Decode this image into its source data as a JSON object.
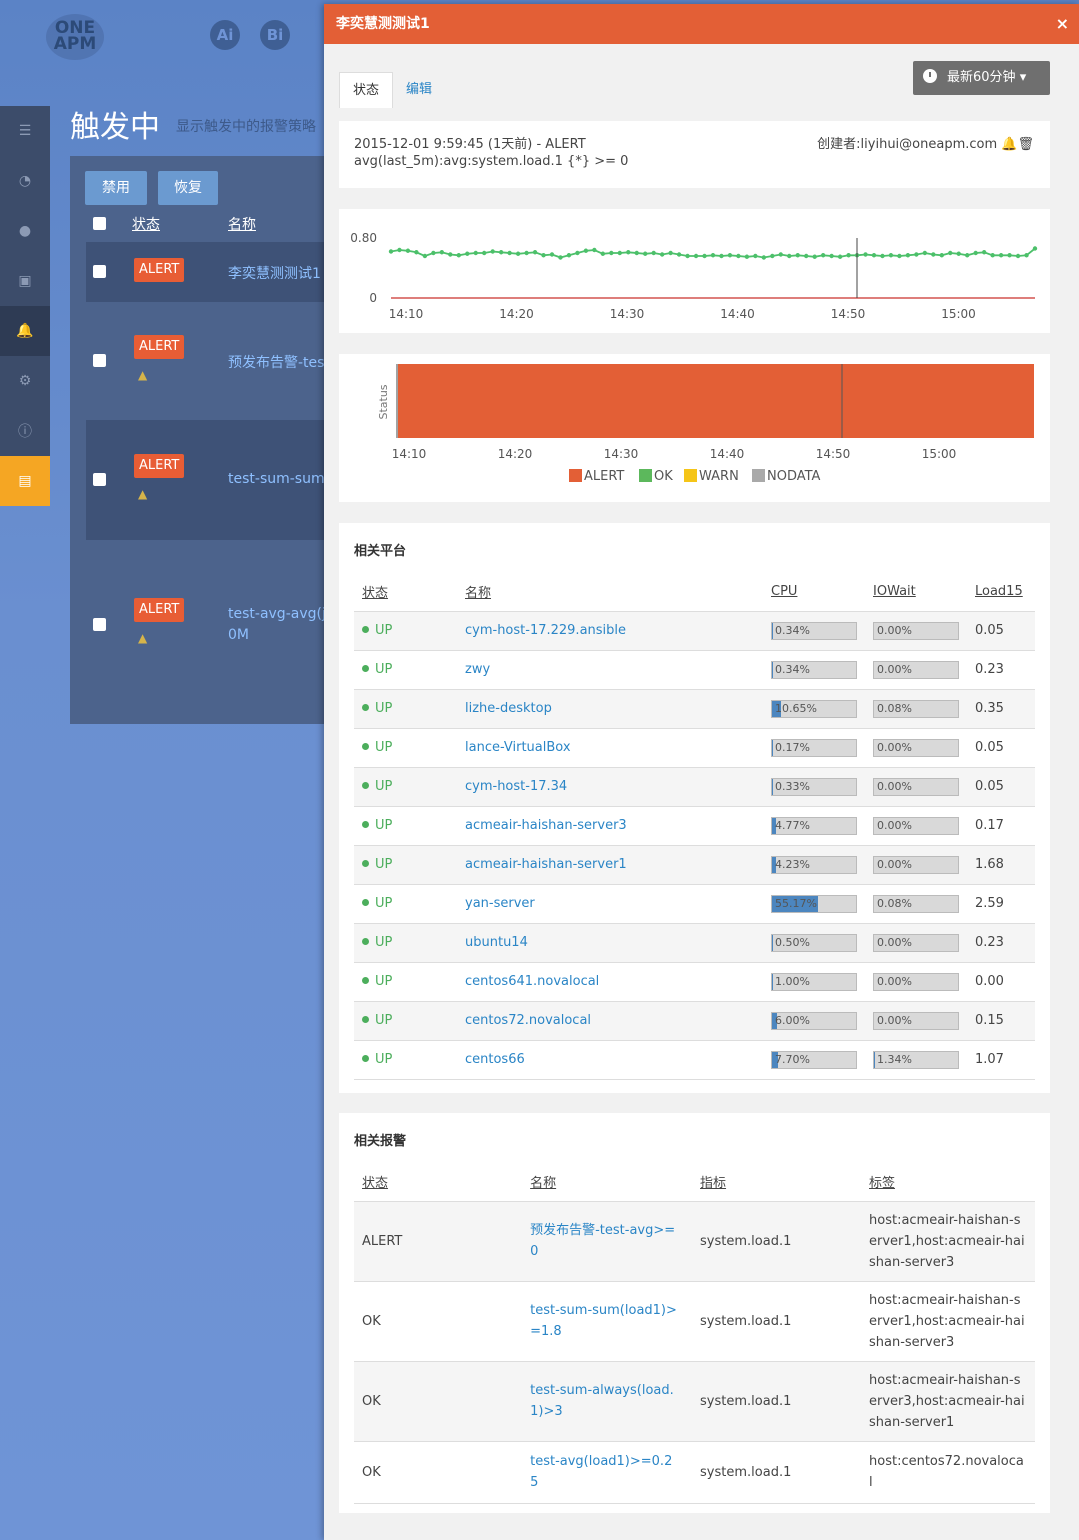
{
  "background": {
    "logo_text": "ONE APM",
    "top_icons": [
      "Ai",
      "Bi"
    ],
    "page_title": "触发中",
    "page_subtitle": "显示触发中的报警策略",
    "buttons": {
      "disable": "禁用",
      "restore": "恢复"
    },
    "headers": {
      "status": "状态",
      "name": "名称"
    },
    "rows": [
      {
        "status": "ALERT",
        "name": "李奕慧测测试1",
        "muted": false
      },
      {
        "status": "ALERT",
        "name": "预发布告警-test",
        "muted": true
      },
      {
        "status": "ALERT",
        "name": "test-sum-sum(l",
        "muted": true
      },
      {
        "status": "ALERT",
        "name": "test-avg-avg(jvm",
        "name2": "0M",
        "muted": true
      }
    ]
  },
  "modal": {
    "title": "李奕慧测测试1",
    "close": "×",
    "tabs": [
      "状态",
      "编辑"
    ],
    "time_button": "最新60分钟",
    "alert_info": {
      "line1": "2015-12-01 9:59:45  (1天前) - ALERT",
      "line2": "avg(last_5m):avg:system.load.1 {*} >= 0",
      "creator": "创建者:liyihui@oneapm.com"
    },
    "status_chart_label": "Status",
    "legend": [
      "ALERT",
      "OK",
      "WARN",
      "NODATA"
    ],
    "platforms": {
      "title": "相关平台",
      "headers": [
        "状态",
        "名称",
        "CPU",
        "IOWait",
        "Load15"
      ],
      "rows": [
        {
          "status": "UP",
          "name": "cym-host-17.229.ansible",
          "cpu": "0.34%",
          "cpu_v": 0.34,
          "iowait": "0.00%",
          "io_v": 0.0,
          "load": "0.05"
        },
        {
          "status": "UP",
          "name": "zwy",
          "cpu": "0.34%",
          "cpu_v": 0.34,
          "iowait": "0.00%",
          "io_v": 0.0,
          "load": "0.23"
        },
        {
          "status": "UP",
          "name": "lizhe-desktop",
          "cpu": "10.65%",
          "cpu_v": 10.65,
          "iowait": "0.08%",
          "io_v": 0.08,
          "load": "0.35"
        },
        {
          "status": "UP",
          "name": "lance-VirtualBox",
          "cpu": "0.17%",
          "cpu_v": 0.17,
          "iowait": "0.00%",
          "io_v": 0.0,
          "load": "0.05"
        },
        {
          "status": "UP",
          "name": "cym-host-17.34",
          "cpu": "0.33%",
          "cpu_v": 0.33,
          "iowait": "0.00%",
          "io_v": 0.0,
          "load": "0.05"
        },
        {
          "status": "UP",
          "name": "acmeair-haishan-server3",
          "cpu": "4.77%",
          "cpu_v": 4.77,
          "iowait": "0.00%",
          "io_v": 0.0,
          "load": "0.17"
        },
        {
          "status": "UP",
          "name": "acmeair-haishan-server1",
          "cpu": "4.23%",
          "cpu_v": 4.23,
          "iowait": "0.00%",
          "io_v": 0.0,
          "load": "1.68"
        },
        {
          "status": "UP",
          "name": "yan-server",
          "cpu": "55.17%",
          "cpu_v": 55.17,
          "iowait": "0.08%",
          "io_v": 0.08,
          "load": "2.59"
        },
        {
          "status": "UP",
          "name": "ubuntu14",
          "cpu": "0.50%",
          "cpu_v": 0.5,
          "iowait": "0.00%",
          "io_v": 0.0,
          "load": "0.23"
        },
        {
          "status": "UP",
          "name": "centos641.novalocal",
          "cpu": "1.00%",
          "cpu_v": 1.0,
          "iowait": "0.00%",
          "io_v": 0.0,
          "load": "0.00"
        },
        {
          "status": "UP",
          "name": "centos72.novalocal",
          "cpu": "6.00%",
          "cpu_v": 6.0,
          "iowait": "0.00%",
          "io_v": 0.0,
          "load": "0.15"
        },
        {
          "status": "UP",
          "name": "centos66",
          "cpu": "7.70%",
          "cpu_v": 7.7,
          "iowait": "1.34%",
          "io_v": 1.34,
          "load": "1.07"
        }
      ]
    },
    "alerts": {
      "title": "相关报警",
      "headers": [
        "状态",
        "名称",
        "指标",
        "标签"
      ],
      "rows": [
        {
          "status": "ALERT",
          "name": "预发布告警-test-avg>=0",
          "metric": "system.load.1",
          "tags": "host:acmeair-haishan-server1,host:acmeair-haishan-server3"
        },
        {
          "status": "OK",
          "name": "test-sum-sum(load1)>=1.8",
          "metric": "system.load.1",
          "tags": "host:acmeair-haishan-server1,host:acmeair-haishan-server3"
        },
        {
          "status": "OK",
          "name": "test-sum-always(load.1)>3",
          "metric": "system.load.1",
          "tags": "host:acmeair-haishan-server3,host:acmeair-haishan-server1"
        },
        {
          "status": "OK",
          "name": "test-avg(load1)>=0.25",
          "metric": "system.load.1",
          "tags": "host:centos72.novalocal"
        }
      ]
    }
  },
  "chart_data": [
    {
      "type": "line",
      "x_ticks": [
        "14:10",
        "14:20",
        "14:30",
        "14:40",
        "14:50",
        "15:00"
      ],
      "y_ticks": [
        "0",
        "0.80"
      ],
      "ylim": [
        0,
        0.8
      ],
      "series": [
        {
          "values": [
            0.62,
            0.64,
            0.63,
            0.61,
            0.56,
            0.6,
            0.61,
            0.58,
            0.57,
            0.59,
            0.6,
            0.6,
            0.62,
            0.61,
            0.6,
            0.59,
            0.6,
            0.61,
            0.57,
            0.58,
            0.54,
            0.57,
            0.6,
            0.63,
            0.64,
            0.59,
            0.6,
            0.6,
            0.61,
            0.6,
            0.59,
            0.6,
            0.58,
            0.6,
            0.58,
            0.56,
            0.56,
            0.56,
            0.57,
            0.56,
            0.57,
            0.56,
            0.55,
            0.56,
            0.54,
            0.56,
            0.58,
            0.56,
            0.57,
            0.56,
            0.55,
            0.57,
            0.56,
            0.55,
            0.57,
            0.57,
            0.58,
            0.57,
            0.56,
            0.57,
            0.56,
            0.57,
            0.58,
            0.6,
            0.58,
            0.57,
            0.6,
            0.59,
            0.57,
            0.6,
            0.61,
            0.57,
            0.57,
            0.57,
            0.56,
            0.57,
            0.66
          ]
        }
      ],
      "baseline_color": "#c9302c",
      "line_color": "#4cc06a"
    },
    {
      "type": "bar",
      "x_ticks": [
        "14:10",
        "14:20",
        "14:30",
        "14:40",
        "14:50",
        "15:00"
      ],
      "ylabel": "Status",
      "series": [
        {
          "name": "ALERT",
          "color": "#e35f36"
        },
        {
          "name": "OK",
          "color": "#5cb85c"
        },
        {
          "name": "WARN",
          "color": "#f5c518"
        },
        {
          "name": "NODATA",
          "color": "#a9a9a9"
        }
      ]
    }
  ]
}
